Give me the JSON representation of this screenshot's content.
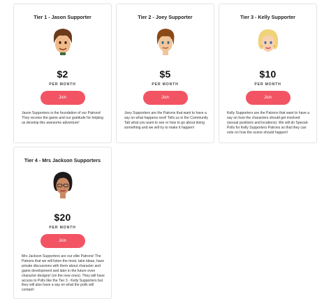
{
  "tiers": [
    {
      "title": "Tier 1 - Jason Supporter",
      "price": "$2",
      "period": "PER MONTH",
      "button": "Join",
      "description": "Jason Supporters is the foundation of our Patrons! They receive the game and our gratitude for helping us develop this awesome adventure!",
      "avatar": "jason-avatar"
    },
    {
      "title": "Tier 2 - Joey Supporter",
      "price": "$5",
      "period": "PER MONTH",
      "button": "Join",
      "description": "Joey Supporters are the Patrons that want to have a say on what happens next! Tells us in the Community Tab what you want to see or how to go about doing something and we will try to make it happen!",
      "avatar": "joey-avatar"
    },
    {
      "title": "Tier 3 - Kelly Supporter",
      "price": "$10",
      "period": "PER MONTH",
      "button": "Join",
      "description": "Kelly Supporters are the Patrons that want to have a say on how the characters should get involved (sexual positions and locations). We will do Special-Polls for Kelly Supporters Patrons so that they can vote on how the scene should happen!",
      "avatar": "kelly-avatar"
    },
    {
      "title": "Tier 4 - Mrs Jackson Supporters",
      "price": "$20",
      "period": "PER MONTH",
      "button": "Join",
      "description": "Mrs Jackson Supporters are our elite Patrons! The Patrons that we will listen the most, take ideas, have private discussions with them about character and game development and later in the future even character designs! (on the new ones). They will have access to Polls like the Tier 3 - Kelly Supporters but they will also have a say on what the polls will contain!",
      "avatar": "mrs-jackson-avatar"
    }
  ]
}
